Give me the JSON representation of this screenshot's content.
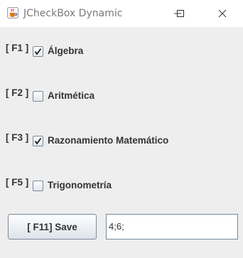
{
  "window": {
    "title": "JCheckBox Dynamic",
    "icon": "java-cup-icon",
    "controls": [
      "minimize-icon",
      "maximize-icon",
      "close-icon"
    ]
  },
  "options": [
    {
      "key": "[ F1 ]",
      "label": "Álgebra",
      "checked": true
    },
    {
      "key": "[ F2 ]",
      "label": "Aritmética",
      "checked": false
    },
    {
      "key": "[ F3 ]",
      "label": "Razonamiento Matemático",
      "checked": true
    },
    {
      "key": "[ F5 ]",
      "label": "Trigonometría",
      "checked": false
    }
  ],
  "save_button": {
    "label": "[ F11] Save"
  },
  "result_field": {
    "value": "4;6;"
  }
}
